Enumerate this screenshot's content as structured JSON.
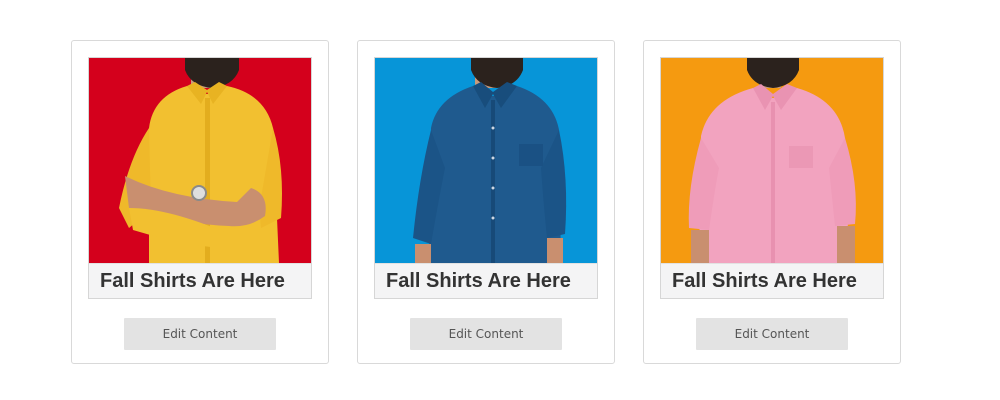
{
  "cards": [
    {
      "photo": "man-in-yellow-shirt-photo",
      "background_color": "#d4001c",
      "shirt_color": "#f2c030",
      "caption": "Fall Shirts Are Here",
      "button_label": "Edit Content"
    },
    {
      "photo": "man-in-denim-shirt-photo",
      "background_color": "#0795d8",
      "shirt_color": "#1f5a8e",
      "caption": "Fall Shirts Are Here",
      "button_label": "Edit Content"
    },
    {
      "photo": "man-in-pink-shirt-photo",
      "background_color": "#f59a10",
      "shirt_color": "#f2a3bf",
      "caption": "Fall Shirts Are Here",
      "button_label": "Edit Content"
    }
  ]
}
